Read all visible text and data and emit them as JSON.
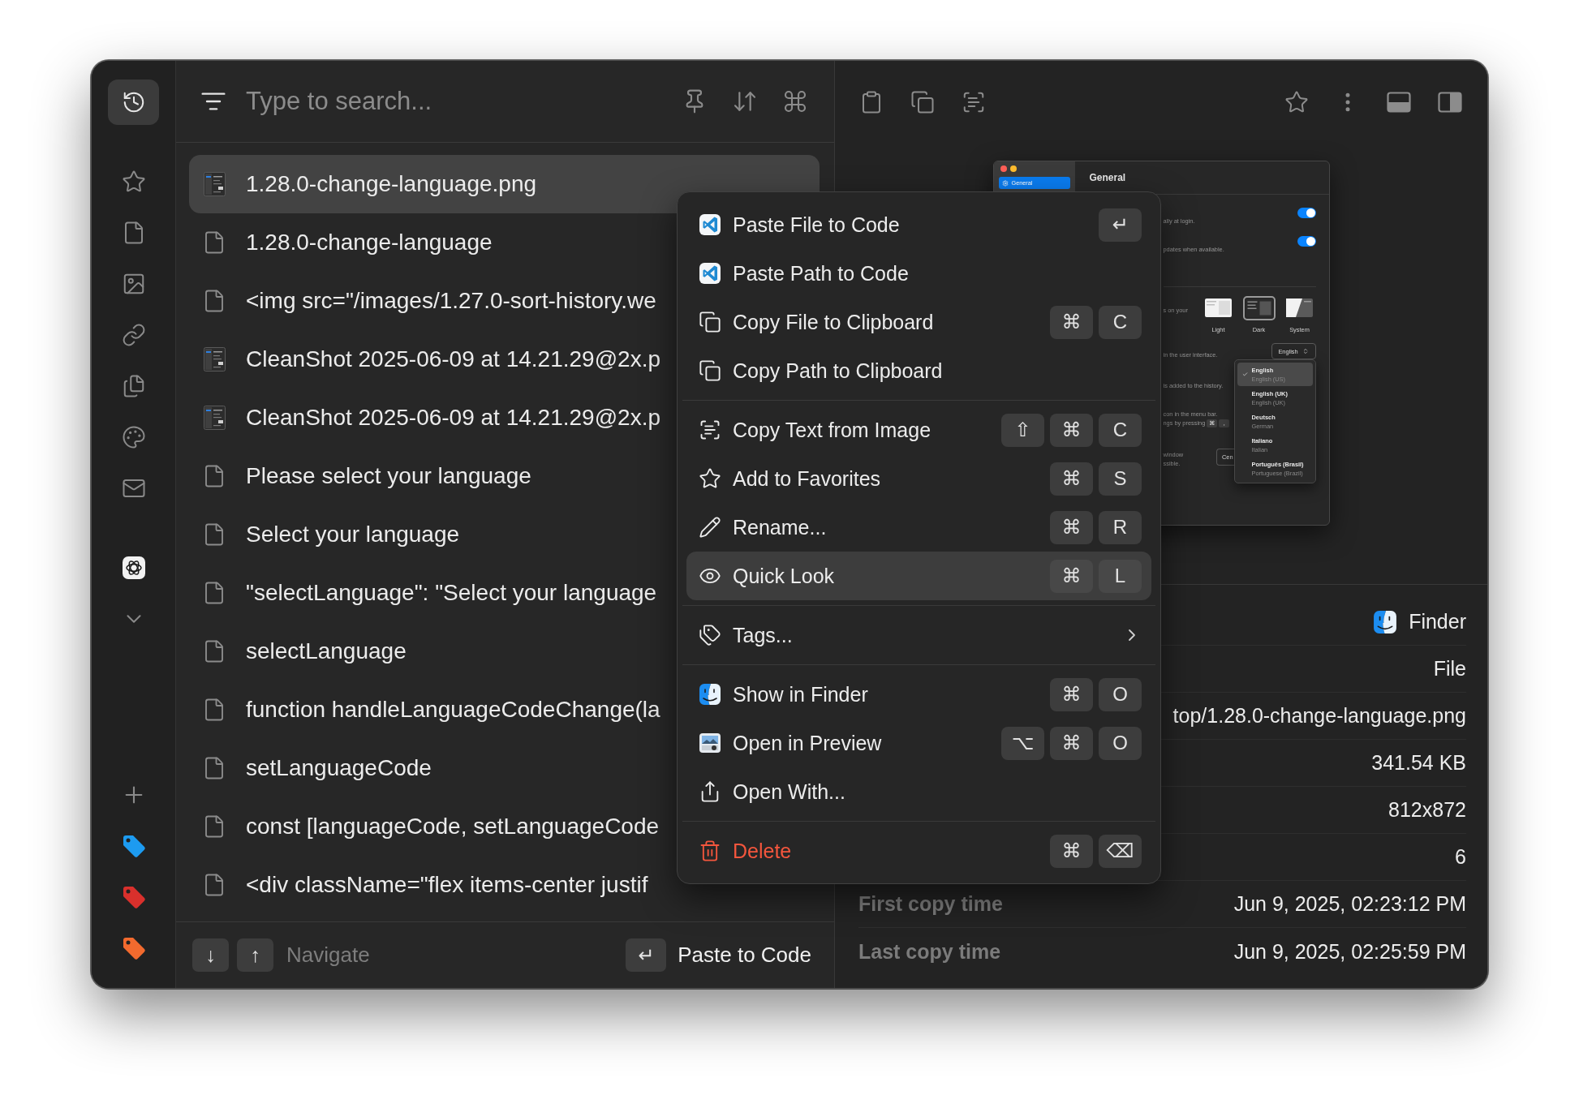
{
  "sidebar": {
    "items": [
      {
        "kind": "history",
        "selected": true
      },
      {
        "kind": "favorites",
        "selected": false
      },
      {
        "kind": "files",
        "selected": false
      },
      {
        "kind": "images",
        "selected": false
      },
      {
        "kind": "links",
        "selected": false
      },
      {
        "kind": "documents",
        "selected": false
      },
      {
        "kind": "colors",
        "selected": false
      },
      {
        "kind": "emails",
        "selected": false
      },
      {
        "kind": "app",
        "selected": false
      }
    ],
    "tags": [
      {
        "color": "#1d9bf0"
      },
      {
        "color": "#d9302c"
      },
      {
        "color": "#f26a2e"
      }
    ]
  },
  "search": {
    "placeholder": "Type to search..."
  },
  "history": [
    {
      "text": "1.28.0-change-language.png",
      "kind": "image",
      "selected": true
    },
    {
      "text": "1.28.0-change-language",
      "kind": "file",
      "selected": false
    },
    {
      "text": "<img src=\"/images/1.27.0-sort-history.we",
      "kind": "file",
      "selected": false
    },
    {
      "text": "CleanShot 2025-06-09 at 14.21.29@2x.p",
      "kind": "image",
      "selected": false
    },
    {
      "text": "CleanShot 2025-06-09 at 14.21.29@2x.p",
      "kind": "image",
      "selected": false
    },
    {
      "text": "Please select your language",
      "kind": "file",
      "selected": false
    },
    {
      "text": "Select your language",
      "kind": "file",
      "selected": false
    },
    {
      "text": "\"selectLanguage\": \"Select your language",
      "kind": "file",
      "selected": false
    },
    {
      "text": "selectLanguage",
      "kind": "file",
      "selected": false
    },
    {
      "text": "function handleLanguageCodeChange(la",
      "kind": "file",
      "selected": false
    },
    {
      "text": "setLanguageCode",
      "kind": "file",
      "selected": false
    },
    {
      "text": "const [languageCode, setLanguageCode",
      "kind": "file",
      "selected": false
    },
    {
      "text": "<div className=\"flex items-center justif",
      "kind": "file",
      "selected": false
    }
  ],
  "footer": {
    "navigate": {
      "keys": [
        "↓",
        "↑"
      ],
      "label": "Navigate"
    },
    "action": {
      "keys": [
        "↵"
      ],
      "label": "Paste to Code"
    }
  },
  "preview": {
    "sidebar_item": {
      "label": "General",
      "selected": true
    },
    "title": "General",
    "settings": [
      {
        "kind": "toggle",
        "lines": [
          "ally at login."
        ],
        "on": true
      },
      {
        "kind": "toggle",
        "lines": [
          "pdates when available."
        ],
        "on": true
      },
      {
        "kind": "theme",
        "lines": [
          "s on your"
        ],
        "options": [
          {
            "kind": "light",
            "label": "Light",
            "selected": false
          },
          {
            "kind": "dark",
            "label": "Dark",
            "selected": true
          },
          {
            "kind": "system",
            "label": "System",
            "selected": false
          }
        ]
      },
      {
        "kind": "select",
        "lines": [
          "in the user interface."
        ],
        "value": "English"
      },
      {
        "kind": "text",
        "lines": [
          "is added to the history."
        ]
      },
      {
        "kind": "keys",
        "lines": [
          "con in the menu bar.",
          "ngs by pressing"
        ],
        "keys": [
          "⌘",
          ","
        ]
      },
      {
        "kind": "button",
        "lines": [
          "window",
          "ssible."
        ],
        "button": "Cen"
      }
    ],
    "language_menu": [
      {
        "label": "English",
        "sublabel": "English (US)",
        "selected": true
      },
      {
        "label": "English (UK)",
        "sublabel": "English (UK)",
        "selected": false
      },
      {
        "label": "Deutsch",
        "sublabel": "German",
        "selected": false
      },
      {
        "label": "Italiano",
        "sublabel": "Italian",
        "selected": false
      },
      {
        "label": "Português (Brasil)",
        "sublabel": "Portuguese (Brazil)",
        "selected": false
      }
    ]
  },
  "details": [
    {
      "kind": "app",
      "value": "Finder"
    },
    {
      "kind": "text",
      "value": "File"
    },
    {
      "kind": "text",
      "value": "top/1.28.0-change-language.png"
    },
    {
      "kind": "text",
      "value": "341.54 KB"
    },
    {
      "kind": "text",
      "value": "812x872"
    },
    {
      "kind": "text",
      "value": "6"
    },
    {
      "kind": "text",
      "label": "First copy time",
      "value": "Jun 9, 2025, 02:23:12 PM"
    },
    {
      "kind": "text",
      "label": "Last copy time",
      "value": "Jun 9, 2025, 02:25:59 PM"
    }
  ],
  "context_menu": {
    "groups": [
      [
        {
          "kind": "paste-file",
          "label": "Paste File to Code",
          "shortcut": [
            "↵"
          ],
          "selected": false,
          "submenu": false,
          "destructive": false
        },
        {
          "kind": "paste-path",
          "label": "Paste Path to Code",
          "selected": false,
          "submenu": false,
          "destructive": false
        },
        {
          "kind": "copy-file",
          "label": "Copy File to Clipboard",
          "shortcut": [
            "⌘",
            "C"
          ],
          "selected": false,
          "submenu": false,
          "destructive": false
        },
        {
          "kind": "copy-path",
          "label": "Copy Path to Clipboard",
          "selected": false,
          "submenu": false,
          "destructive": false
        }
      ],
      [
        {
          "kind": "ocr",
          "label": "Copy Text from Image",
          "shortcut": [
            "⇧",
            "⌘",
            "C"
          ],
          "selected": false,
          "submenu": false,
          "destructive": false
        },
        {
          "kind": "favorite",
          "label": "Add to Favorites",
          "shortcut": [
            "⌘",
            "S"
          ],
          "selected": false,
          "submenu": false,
          "destructive": false
        },
        {
          "kind": "rename",
          "label": "Rename...",
          "shortcut": [
            "⌘",
            "R"
          ],
          "selected": false,
          "submenu": false,
          "destructive": false
        },
        {
          "kind": "quick-look",
          "label": "Quick Look",
          "shortcut": [
            "⌘",
            "L"
          ],
          "selected": true,
          "submenu": false,
          "destructive": false
        }
      ],
      [
        {
          "kind": "tags",
          "label": "Tags...",
          "selected": false,
          "submenu": true,
          "destructive": false
        }
      ],
      [
        {
          "kind": "reveal",
          "label": "Show in Finder",
          "shortcut": [
            "⌘",
            "O"
          ],
          "selected": false,
          "submenu": false,
          "destructive": false
        },
        {
          "kind": "preview",
          "label": "Open in Preview",
          "shortcut": [
            "⌥",
            "⌘",
            "O"
          ],
          "selected": false,
          "submenu": false,
          "destructive": false
        },
        {
          "kind": "open-with",
          "label": "Open With...",
          "selected": false,
          "submenu": false,
          "destructive": false
        }
      ],
      [
        {
          "kind": "delete",
          "label": "Delete",
          "shortcut": [
            "⌘",
            "⌫"
          ],
          "selected": false,
          "submenu": false,
          "destructive": true
        }
      ]
    ]
  }
}
